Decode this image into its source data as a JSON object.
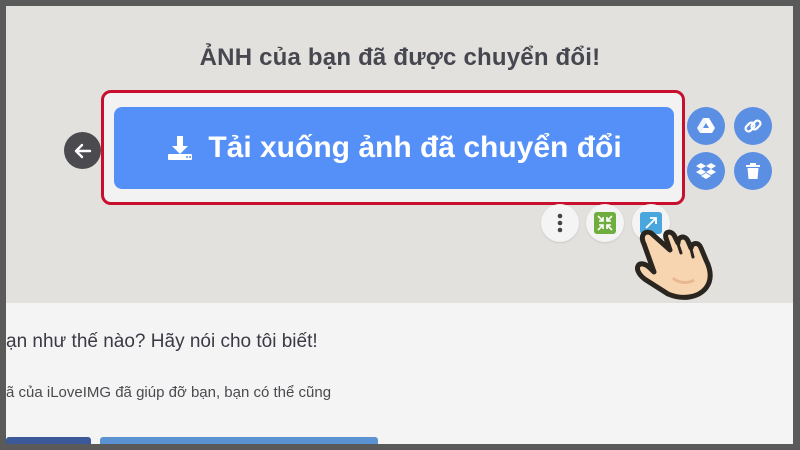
{
  "result": {
    "headline": "ẢNH của bạn đã được chuyển đổi!",
    "download_label": "Tải xuống ảnh đã chuyển đổi"
  },
  "feedback": {
    "title": "ạn như thế nào? Hãy nói cho tôi biết!",
    "text": "ã của iLoveIMG đã giúp đỡ bạn, bạn có thể cũng"
  },
  "colors": {
    "primary_button": "#5490f8",
    "highlight_border": "#c8102e",
    "action_circle": "#5b8fe3",
    "back_button": "#4a4a4f"
  },
  "icons": {
    "download": "download-icon",
    "back": "arrow-left-icon",
    "gdrive": "google-drive-icon",
    "link": "link-icon",
    "dropbox": "dropbox-icon",
    "trash": "trash-icon",
    "more": "more-vertical-icon",
    "compress": "compress-icon",
    "resize": "resize-icon",
    "cursor": "pointing-hand-icon"
  }
}
